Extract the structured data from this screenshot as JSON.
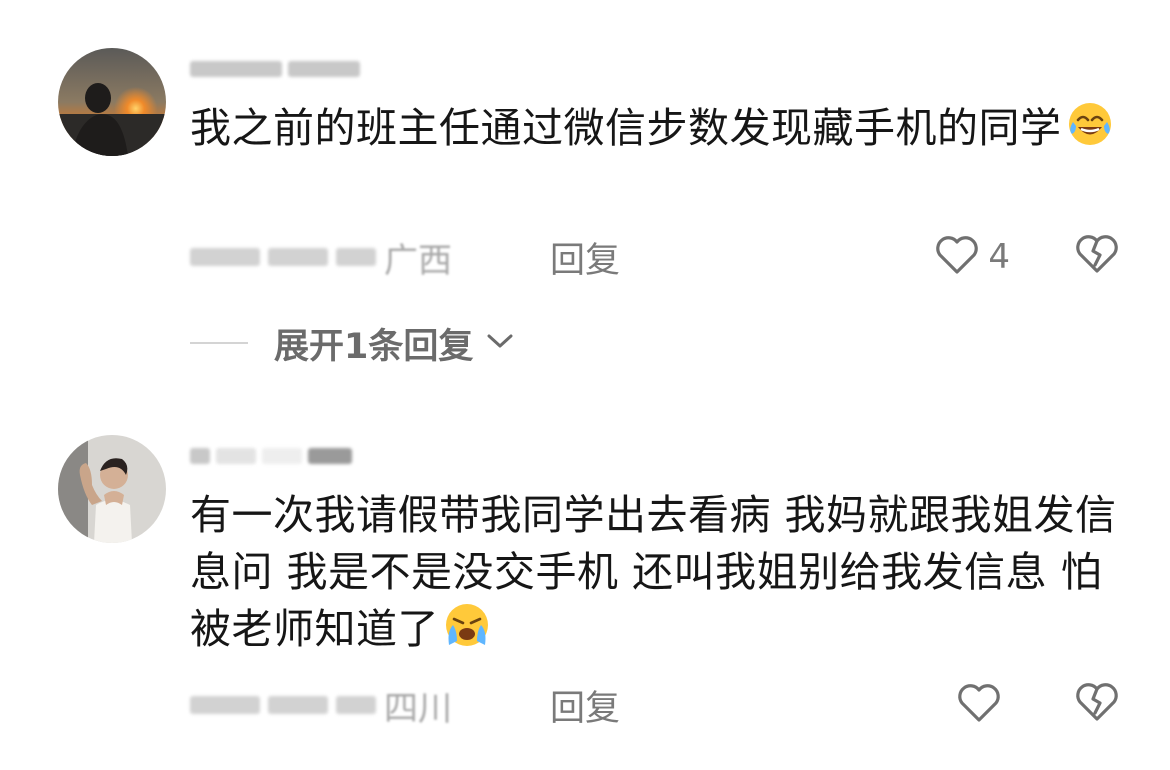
{
  "comments": [
    {
      "text": "我之前的班主任通过微信步数发现藏手机的同学",
      "emoji": "laughing-tears-emoji",
      "location": "广西",
      "reply_label": "回复",
      "like_count": "4",
      "expand_label": "展开1条回复"
    },
    {
      "text": "有一次我请假带我同学出去看病 我妈就跟我姐发信息问 我是不是没交手机 还叫我姐别给我发信息 怕被老师知道了",
      "emoji": "crying-emoji",
      "location": "四川",
      "reply_label": "回复",
      "like_count": ""
    }
  ],
  "icons": {
    "like": "heart-outline-icon",
    "dislike": "broken-heart-icon",
    "expand": "chevron-down-icon"
  },
  "colors": {
    "text": "#161616",
    "meta": "#a4a4a4",
    "action": "#7a7a7a",
    "icon_stroke": "#707070"
  }
}
